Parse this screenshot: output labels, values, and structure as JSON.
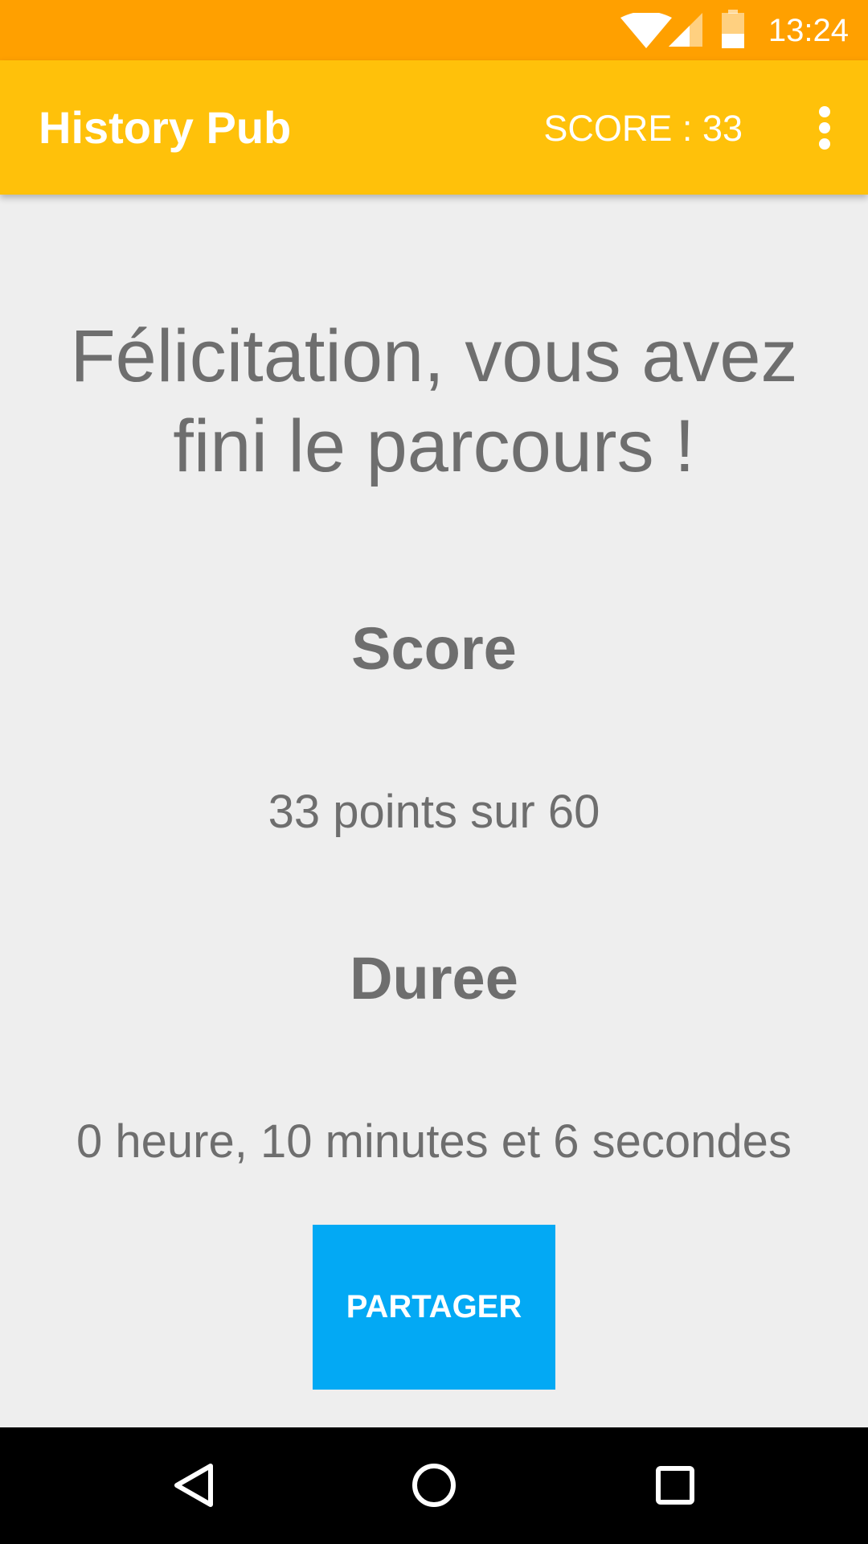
{
  "status_bar": {
    "time": "13:24",
    "icons": [
      "wifi-icon",
      "cellular-signal-icon",
      "battery-icon"
    ]
  },
  "app_bar": {
    "title": "History Pub",
    "score": "SCORE : 33",
    "menu_icon": "more-vert-icon"
  },
  "main": {
    "headline": "Félicitation, vous avez fini le parcours !",
    "score_title": "Score",
    "score_value": "33 points sur 60",
    "duration_title": "Duree",
    "duration_value": "0 heure, 10 minutes et 6 secondes",
    "share_label": "PARTAGER"
  },
  "nav_bar": {
    "icons": [
      "back-icon",
      "home-icon",
      "recents-icon"
    ]
  },
  "colors": {
    "status_bar": "#FFA000",
    "app_bar": "#FFC10A",
    "background": "#EEEEEE",
    "text": "#6E6E6E",
    "button": "#03A9F4",
    "nav_bar": "#000000"
  }
}
